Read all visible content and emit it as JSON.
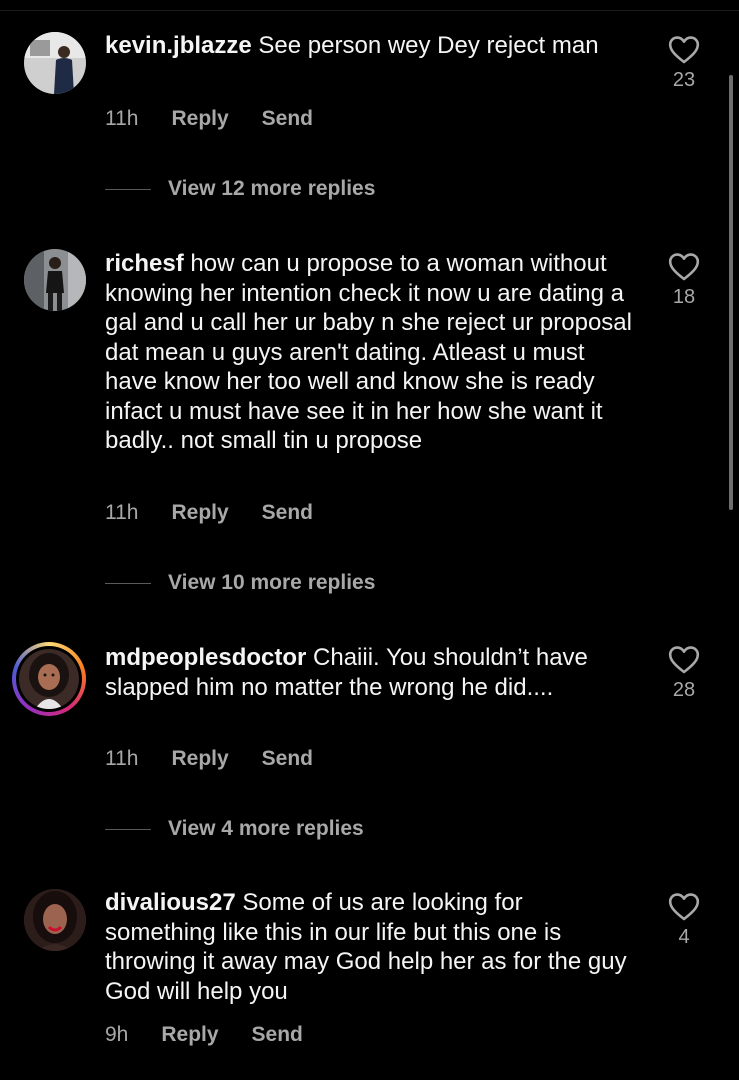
{
  "comments": [
    {
      "username": "kevin.jblazze",
      "text": "See person wey Dey reject man",
      "time": "11h",
      "reply_label": "Reply",
      "send_label": "Send",
      "likes": "23",
      "view_replies": "View 12 more replies"
    },
    {
      "username": "richesf",
      "text": "how can u propose to a woman without knowing her intention check it now u are dating a gal and u call her ur baby n she reject ur proposal dat mean u guys aren't dating. Atleast u must have know her too well and know she is ready infact u must have see it in her how she want it badly.. not small tin u propose",
      "time": "11h",
      "reply_label": "Reply",
      "send_label": "Send",
      "likes": "18",
      "view_replies": "View 10 more replies"
    },
    {
      "username": "mdpeoplesdoctor",
      "text": "Chaiii. You shouldn’t have slapped him no matter the wrong he did....",
      "time": "11h",
      "reply_label": "Reply",
      "send_label": "Send",
      "likes": "28",
      "view_replies": "View 4 more replies"
    },
    {
      "username": "divalious27",
      "text": "Some of us are looking for something like this in our life but this one is throwing it away may God help her as for the guy God will help you",
      "time": "9h",
      "reply_label": "Reply",
      "send_label": "Send",
      "likes": "4"
    }
  ],
  "icons": {
    "like": "heart-outline-icon"
  },
  "colors": {
    "background": "#000000",
    "text": "#f5f5f5",
    "secondary": "#a8a8a8",
    "story_ring": [
      "#feda75",
      "#fa7e1e",
      "#d62976",
      "#962fbf",
      "#4f5bd5"
    ]
  }
}
